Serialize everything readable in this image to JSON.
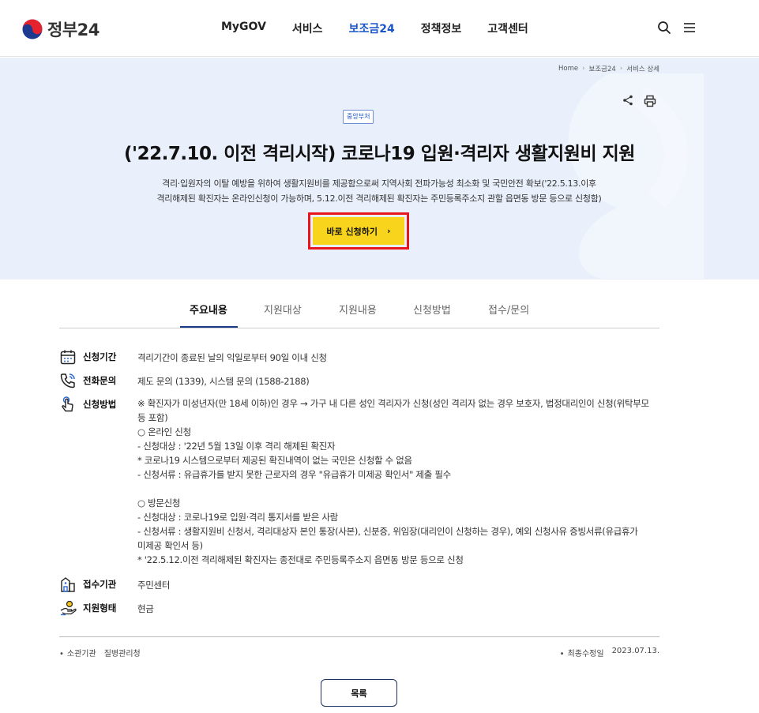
{
  "header": {
    "logo_text": "정부24",
    "nav": [
      "MyGOV",
      "서비스",
      "보조금24",
      "정책정보",
      "고객센터"
    ],
    "active_nav": "보조금24"
  },
  "breadcrumb": [
    "Home",
    "보조금24",
    "서비스 상세"
  ],
  "hero": {
    "org_tag": "중앙부처",
    "title": "('22.7.10. 이전 격리시작) 코로나19 입원·격리자 생활지원비 지원",
    "desc_line1": "격리·입원자의 이탈 예방을 위하여 생활지원비를 제공함으로써 지역사회 전파가능성 최소화 및 국민안전 확보('22.5.13.이후",
    "desc_line2": "격리해제된 확진자는 온라인신청이 가능하며, 5.12.이전 격리해제된 확진자는 주민등록주소지 관할 읍면동 방문 등으로 신청함)",
    "apply_label": "바로 신청하기",
    "apply_arrow": "›"
  },
  "tabs": [
    "주요내용",
    "지원대상",
    "지원내용",
    "신청방법",
    "접수/문의"
  ],
  "details": {
    "period_label": "신청기간",
    "period_value": "격리기간이 종료된 날의 익일로부터 90일 이내 신청",
    "phone_label": "전화문의",
    "phone_value": "제도 문의 (1339), 시스템 문의 (1588-2188)",
    "method_label": "신청방법",
    "method_lines": [
      "※ 확진자가 미성년자(만 18세 이하)인 경우 → 가구 내 다른 성인 격리자가 신청(성인 격리자 없는 경우 보호자, 법정대리인이 신청(위탁부모",
      "등 포함)",
      "○ 온라인 신청",
      "- 신청대상 : '22년 5월 13일 이후 격리 해제된 확진자",
      "* 코로나19 시스템으로부터 제공된 확진내역이 없는 국민은 신청할 수 없음",
      "- 신청서류 : 유급휴가를 받지 못한 근로자의 경우 \"유급휴가 미제공 확인서\" 제출 필수",
      "",
      "○ 방문신청",
      "- 신청대상 : 코로나19로 입원·격리 통지서를 받은 사람",
      "- 신청서류 : 생활지원비 신청서, 격리대상자 본인 통장(사본), 신분증, 위임장(대리인이 신청하는 경우), 예외 신청사유 증빙서류(유급휴가",
      "미제공 확인서 등)",
      "* '22.5.12.이전 격리해제된 확진자는 종전대로 주민등록주소지 읍면동 방문 등으로 신청"
    ],
    "agency_label": "접수기관",
    "agency_value": "주민센터",
    "type_label": "지원형태",
    "type_value": "현금"
  },
  "meta": {
    "org_label": "소관기관",
    "org_value": "질병관리청",
    "updated_label": "최종수정일",
    "updated_value": "2023.07.13."
  },
  "list_button": "목록",
  "colors": {
    "accent_blue": "#1a56c8",
    "hero_bg": "#e9f0fb",
    "apply_yellow": "#f9d41c",
    "highlight_red": "#e8151d"
  }
}
